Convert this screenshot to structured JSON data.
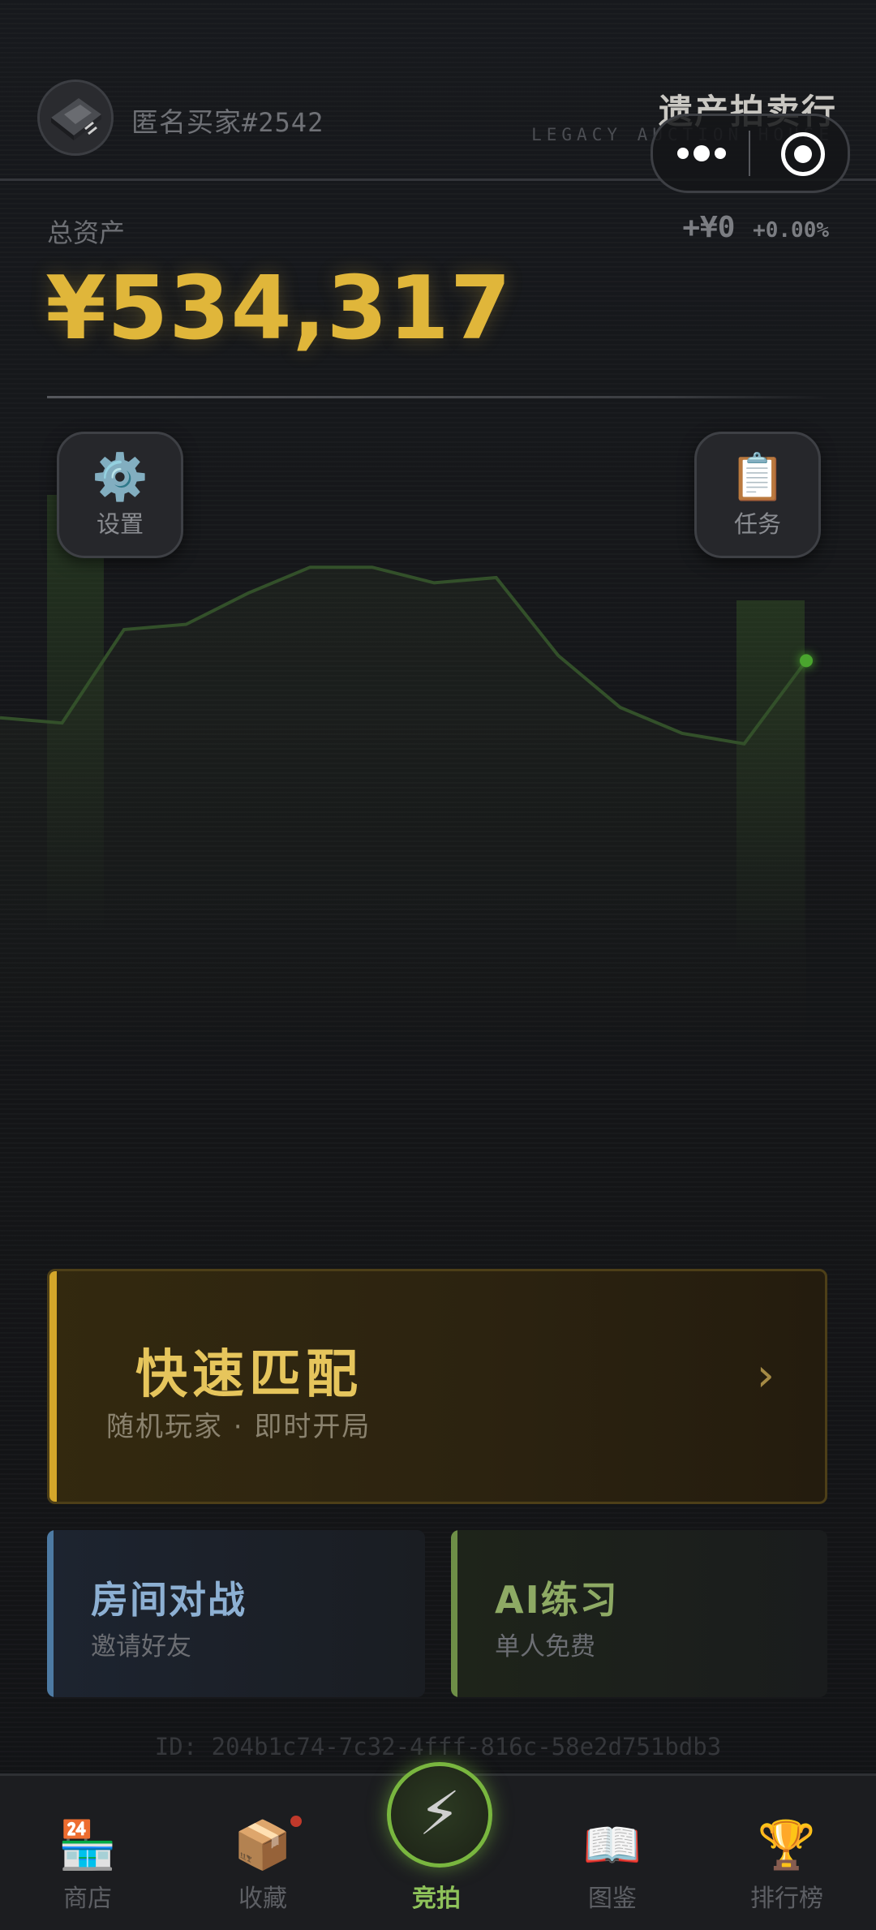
{
  "header": {
    "username": "匿名买家",
    "user_tag": "#2542",
    "brand_title": "遗产拍卖行",
    "brand_subtitle": "LEGACY AUCTION HOUSE"
  },
  "mini_capsule": {
    "more_icon": "more-dots-icon",
    "close_icon": "target-circle-icon"
  },
  "assets": {
    "label": "总资产",
    "value": "¥534,317",
    "change_amount": "+¥0",
    "change_percent": "+0.00%"
  },
  "chart_data": {
    "type": "line",
    "title": "",
    "xlabel": "",
    "ylabel": "",
    "grid": false,
    "series": [
      {
        "values": [
          523,
          522,
          540,
          541,
          547,
          552,
          552,
          549,
          550,
          535,
          525,
          520,
          518,
          534
        ]
      }
    ],
    "y_range": [
      480,
      580
    ]
  },
  "actions": {
    "settings": {
      "icon": "gear-icon",
      "label": "设置"
    },
    "tasks": {
      "icon": "clipboard-icon",
      "label": "任务"
    }
  },
  "quick_match": {
    "title": "快速匹配",
    "subtitle": "随机玩家 · 即时开局"
  },
  "room_battle": {
    "title": "房间对战",
    "subtitle": "邀请好友"
  },
  "ai_practice": {
    "title": "AI练习",
    "subtitle": "单人免费"
  },
  "user_id": "ID: 204b1c74-7c32-4fff-816c-58e2d751bdb3",
  "tabs": [
    {
      "label": "商店",
      "icon": "store-icon"
    },
    {
      "label": "收藏",
      "icon": "package-icon"
    },
    {
      "label": "竞拍",
      "icon": "lightning-icon",
      "active": true
    },
    {
      "label": "图鉴",
      "icon": "book-icon"
    },
    {
      "label": "排行榜",
      "icon": "trophy-icon"
    }
  ],
  "colors": {
    "gold": "#e0b63a",
    "accent_green": "#79b63f",
    "room_blue": "#4d7aa3",
    "ai_green": "#6e8f47"
  }
}
